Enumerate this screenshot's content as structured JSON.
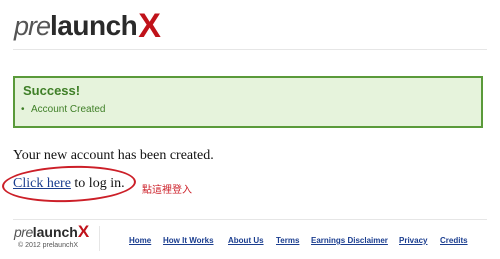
{
  "brand": {
    "pre": "pre",
    "launch": "launch",
    "x": "X"
  },
  "alert": {
    "title": "Success!",
    "items": [
      "Account Created"
    ]
  },
  "main": {
    "message": "Your new account has been created.",
    "login_link": "Click here",
    "login_suffix": " to log in.",
    "annotation": "點這裡登入"
  },
  "footer": {
    "copyright": "© 2012 prelaunchX",
    "links": [
      "Home",
      "How It Works",
      "About Us",
      "Terms",
      "Earnings Disclaimer",
      "Privacy",
      "Credits"
    ]
  },
  "colors": {
    "brand_x": "#c0121a",
    "success_bg": "#e6f3dc",
    "success_border": "#5a9a3a",
    "success_text": "#3f7f27",
    "link": "#1a3d8f",
    "annotation": "#cc1f28"
  }
}
